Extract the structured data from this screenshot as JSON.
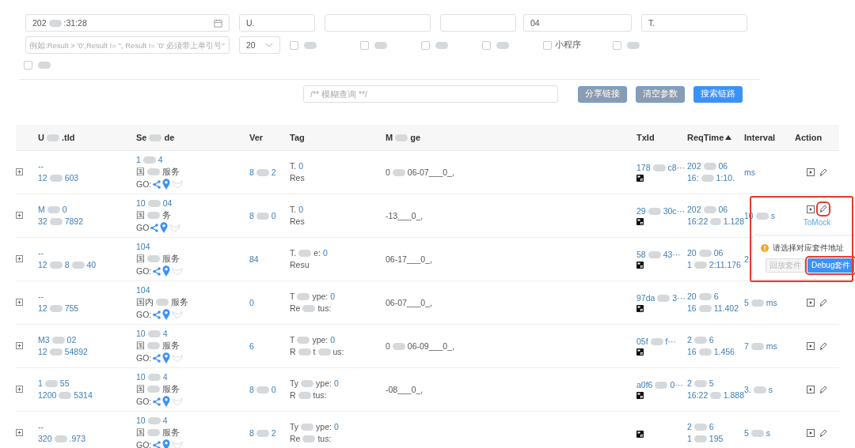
{
  "filters": {
    "row1": [
      {
        "kind": "date",
        "value": [
          "202",
          ":31:28"
        ]
      },
      {
        "kind": "text",
        "value": [
          "U."
        ]
      },
      {
        "kind": "text"
      },
      {
        "kind": "text"
      },
      {
        "kind": "text",
        "value": [
          "04"
        ]
      },
      {
        "kind": "text",
        "value": [
          "T."
        ]
      }
    ],
    "condition": {
      "placeholder": "例如:Result > '0',Result != '', Result != '0' 必须带上单引号''"
    },
    "page_size": "20",
    "checkboxes": [
      {
        "checked": false
      },
      {
        "checked": false
      },
      {
        "checked": false
      },
      {
        "checked": false
      },
      {
        "checked": false,
        "label": "小程序"
      },
      {
        "checked": false
      }
    ],
    "extra_checkbox": {
      "checked": false
    },
    "fuzzy": {
      "placeholder": "/** 模糊查询 **/"
    },
    "buttons": [
      {
        "label": "分享链接",
        "kind": "secondary"
      },
      {
        "label": "清空参数",
        "kind": "secondary"
      },
      {
        "label": "搜索链路",
        "kind": "primary"
      }
    ]
  },
  "table": {
    "columns": [
      {
        "label": [
          "U",
          ".tId"
        ]
      },
      {
        "label": [
          "Se",
          "de"
        ]
      },
      {
        "label": [
          "Ver"
        ]
      },
      {
        "label": [
          "Tag"
        ]
      },
      {
        "label": [
          "M",
          "ge"
        ]
      },
      {
        "label": [
          "TxId"
        ]
      },
      {
        "label": [
          "ReqTime"
        ],
        "sorted_ascending": true
      },
      {
        "label": [
          "Interval"
        ]
      },
      {
        "label": [
          "Action"
        ]
      }
    ],
    "rows": [
      {
        "id": [
          [
            "--"
          ],
          [
            "12",
            "603"
          ]
        ],
        "service": [
          [
            "1",
            "4"
          ],
          [
            "国",
            "服务"
          ]
        ],
        "go": "GO:",
        "ver": [
          "8",
          "2"
        ],
        "tag": {
          "type_label": [
            "T."
          ],
          "type_value": "0",
          "status_label": [
            "Res"
          ]
        },
        "message": [
          "0",
          "06-07___0_,"
        ],
        "txid": [
          "178",
          "c8···"
        ],
        "reqtime": [
          [
            "202",
            "06"
          ],
          [
            "16:",
            "1:10."
          ]
        ],
        "interval": [
          "ms"
        ],
        "show_actions": true
      },
      {
        "id": [
          [
            "M",
            "0"
          ],
          [
            "32",
            "7892"
          ]
        ],
        "service": [
          [
            "10",
            "04"
          ],
          [
            "国",
            "务"
          ]
        ],
        "go": "GO",
        "ver": [
          "8",
          "0"
        ],
        "tag": {
          "type_label": [
            "T."
          ],
          "type_value": "0",
          "status_label": [
            "Res"
          ]
        },
        "message": [
          "-13___0_,"
        ],
        "txid": [
          "29",
          "30c···"
        ],
        "reqtime": [
          [
            "202",
            "06"
          ],
          [
            "16:22",
            "1.128"
          ]
        ],
        "interval": [
          "10",
          "s"
        ],
        "show_actions": true,
        "edit_highlighted": true,
        "tooltip": "ToMock"
      },
      {
        "id": [
          [
            "--"
          ],
          [
            "12",
            "8",
            "40"
          ]
        ],
        "service": [
          [
            "104"
          ],
          [
            "国",
            "服务"
          ]
        ],
        "go": "GO:",
        "ver": [
          "84"
        ],
        "tag": {
          "type_label": [
            "T.",
            "e:"
          ],
          "type_value": "0",
          "status_label": [
            "Resu"
          ]
        },
        "message": [
          "06-17___0_,"
        ],
        "txid": [
          "58",
          "43···"
        ],
        "reqtime": [
          [
            "20",
            "06"
          ],
          [
            "1",
            "2:11.176"
          ]
        ],
        "interval": [
          "2"
        ],
        "show_actions": false
      },
      {
        "id": [
          [
            "--"
          ],
          [
            "12",
            "755"
          ]
        ],
        "service": [
          [
            "104"
          ],
          [
            "国内",
            "服务"
          ]
        ],
        "go": "GO:",
        "ver": [
          "0"
        ],
        "tag": {
          "type_label": [
            "T",
            "ype:"
          ],
          "type_value": "0",
          "status_label": [
            "Re",
            "tus:"
          ]
        },
        "message": [
          "06-07___0_,"
        ],
        "txid": [
          "97da",
          "3···"
        ],
        "reqtime": [
          [
            "20",
            "6"
          ],
          [
            "16",
            "11.402"
          ]
        ],
        "interval": [
          "5",
          "ms"
        ],
        "show_actions": true
      },
      {
        "id": [
          [
            "M3",
            "02"
          ],
          [
            "12",
            "54892"
          ]
        ],
        "service": [
          [
            "10",
            "4"
          ],
          [
            "国",
            "服务"
          ]
        ],
        "go": "GO:",
        "ver": [
          "6"
        ],
        "tag": {
          "type_label": [
            "T",
            "ype:"
          ],
          "type_value": "0",
          "status_label": [
            "R",
            "t",
            "us:"
          ]
        },
        "message": [
          "0",
          "06-09___0_,"
        ],
        "txid": [
          "05f",
          "f···"
        ],
        "reqtime": [
          [
            "2",
            "6"
          ],
          [
            "16",
            "1.456"
          ]
        ],
        "interval": [
          "7",
          "ms"
        ],
        "show_actions": true
      },
      {
        "id": [
          [
            "1",
            "55"
          ],
          [
            "1200",
            "5314"
          ]
        ],
        "service": [
          [
            "10",
            "4"
          ],
          [
            "国",
            "服务"
          ]
        ],
        "go": "GO:",
        "ver": [
          "8",
          "0"
        ],
        "tag": {
          "type_label": [
            "Ty",
            "ype:"
          ],
          "type_value": "0",
          "status_label": [
            "R",
            "tus:"
          ]
        },
        "message": [
          "-08___0_,"
        ],
        "txid": [
          "a0f6",
          "0···"
        ],
        "reqtime": [
          [
            "2",
            "5"
          ],
          [
            "16:22",
            "1.888"
          ]
        ],
        "interval": [
          "3.",
          "s"
        ],
        "show_actions": true
      },
      {
        "id": [
          [
            "--"
          ],
          [
            "320",
            ".973"
          ]
        ],
        "service": [
          [
            "10",
            "4"
          ],
          [
            "国",
            "服务"
          ]
        ],
        "go": "GO:",
        "ver": [
          "8",
          "2"
        ],
        "tag": {
          "type_label": [
            "Ty",
            "ype:"
          ],
          "type_value": "0",
          "status_label": [
            "Re",
            "tus:"
          ]
        },
        "reqtime": [
          [
            "2",
            "6"
          ],
          [
            "1",
            "195"
          ]
        ],
        "interval": [
          "5",
          "s"
        ],
        "show_actions": true
      }
    ]
  },
  "popover": {
    "message": "请选择对应套件地址",
    "highlighted": true,
    "buttons": [
      {
        "label": "回放套件",
        "disabled": true,
        "highlighted": false
      },
      {
        "label": "Debug套件",
        "disabled": false,
        "highlighted": true
      }
    ]
  }
}
